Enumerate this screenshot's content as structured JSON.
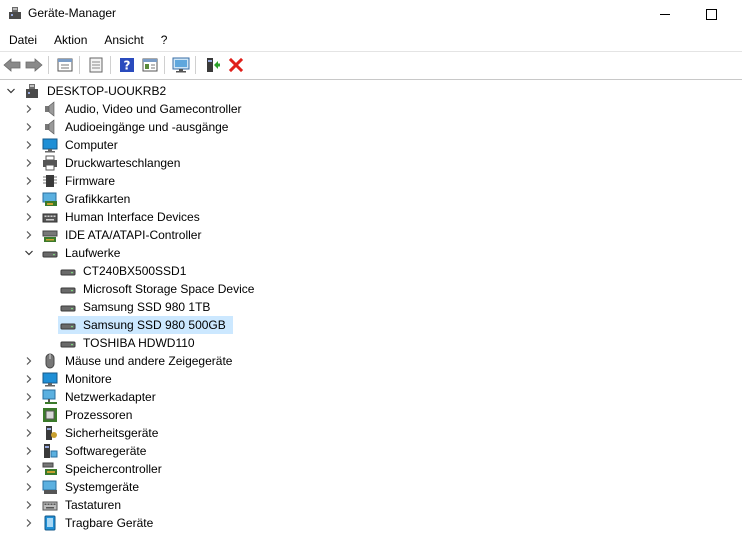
{
  "window": {
    "title": "Geräte-Manager"
  },
  "menu": [
    {
      "label": "Datei"
    },
    {
      "label": "Aktion"
    },
    {
      "label": "Ansicht"
    },
    {
      "label": "?"
    }
  ],
  "toolbar": {
    "buttons": [
      "back-icon",
      "forward-icon",
      "properties-icon",
      "sheet-icon",
      "help-icon",
      "view-icon",
      "monitor-scan-icon",
      "update-driver-icon",
      "uninstall-icon"
    ]
  },
  "tree": {
    "root": {
      "label": "DESKTOP-UOUKRB2",
      "expanded": true,
      "icon": "computer-root-icon"
    },
    "categories": [
      {
        "label": "Audio, Video und Gamecontroller",
        "icon": "speaker-icon"
      },
      {
        "label": "Audioeingänge und -ausgänge",
        "icon": "speaker-icon"
      },
      {
        "label": "Computer",
        "icon": "monitor-icon"
      },
      {
        "label": "Druckwarteschlangen",
        "icon": "printer-icon"
      },
      {
        "label": "Firmware",
        "icon": "chip-icon"
      },
      {
        "label": "Grafikkarten",
        "icon": "display-adapter-icon"
      },
      {
        "label": "Human Interface Devices",
        "icon": "keyboard-icon"
      },
      {
        "label": "IDE ATA/ATAPI-Controller",
        "icon": "ide-controller-icon"
      },
      {
        "label": "Laufwerke",
        "icon": "drive-icon",
        "expanded": true,
        "children": [
          {
            "label": "CT240BX500SSD1",
            "icon": "drive-icon"
          },
          {
            "label": "Microsoft Storage Space Device",
            "icon": "drive-icon"
          },
          {
            "label": "Samsung SSD 980 1TB",
            "icon": "drive-icon"
          },
          {
            "label": "Samsung SSD 980 500GB",
            "icon": "drive-icon",
            "selected": true
          },
          {
            "label": "TOSHIBA HDWD110",
            "icon": "drive-icon"
          }
        ]
      },
      {
        "label": "Mäuse und andere Zeigegeräte",
        "icon": "mouse-icon"
      },
      {
        "label": "Monitore",
        "icon": "monitor-icon"
      },
      {
        "label": "Netzwerkadapter",
        "icon": "network-icon"
      },
      {
        "label": "Prozessoren",
        "icon": "processor-icon"
      },
      {
        "label": "Sicherheitsgeräte",
        "icon": "security-icon"
      },
      {
        "label": "Softwaregeräte",
        "icon": "software-device-icon"
      },
      {
        "label": "Speichercontroller",
        "icon": "storage-controller-icon"
      },
      {
        "label": "Systemgeräte",
        "icon": "system-device-icon"
      },
      {
        "label": "Tastaturen",
        "icon": "keyboard-icon"
      },
      {
        "label": "Tragbare Geräte",
        "icon": "portable-device-icon"
      }
    ]
  },
  "colors": {
    "selection": "#cce8ff",
    "uninstall": "#e0201b",
    "help": "#2a4bbd"
  }
}
